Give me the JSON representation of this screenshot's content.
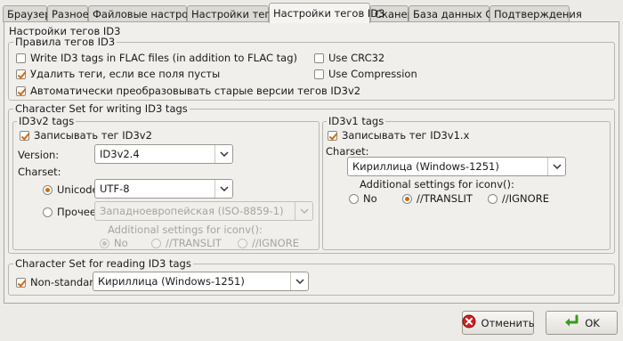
{
  "tabs": [
    "Браузер",
    "Разное",
    "Файловые настройки",
    "Настройки тегов",
    "Настройки тегов ID3",
    "Сканер",
    "База данных CD",
    "Подтверждения"
  ],
  "active_tab": "Настройки тегов ID3",
  "panel_title": "Настройки тегов ID3",
  "rules": {
    "title": "Правила тегов ID3",
    "write_flac": "Write ID3 tags in FLAC files (in addition to FLAC tag)",
    "delete_empty": "Удалить теги, если все поля пусты",
    "auto_convert": "Автоматически преобразовывать старые версии тегов ID3v2",
    "use_crc32": "Use CRC32",
    "use_compression": "Use Compression"
  },
  "writing": {
    "title": "Character Set for writing ID3 tags",
    "id3v2": {
      "title": "ID3v2 tags",
      "write_label": "Записывать тег ID3v2",
      "version_label": "Version:",
      "version_value": "ID3v2.4",
      "charset_label": "Charset:",
      "unicode_label": "Unicode",
      "unicode_value": "UTF-8",
      "other_label": "Прочее",
      "other_value": "Западноевропейская (ISO-8859-1)",
      "iconv_label": "Additional settings for iconv():",
      "opt_no": "No",
      "opt_translit": "//TRANSLIT",
      "opt_ignore": "//IGNORE"
    },
    "id3v1": {
      "title": "ID3v1 tags",
      "write_label": "Записывать тег ID3v1.x",
      "charset_label": "Charset:",
      "charset_value": "Кириллица (Windows-1251)",
      "iconv_label": "Additional settings for iconv():",
      "opt_no": "No",
      "opt_translit": "//TRANSLIT",
      "opt_ignore": "//IGNORE"
    }
  },
  "reading": {
    "title": "Character Set for reading ID3 tags",
    "nonstandard_label": "Non-standart:",
    "nonstandard_value": "Кириллица (Windows-1251)"
  },
  "buttons": {
    "cancel": "Отменить",
    "ok": "OK"
  },
  "colors": {
    "check_accent": "#d06a10",
    "cancel_icon": "#cc2222",
    "ok_icon": "#3a9a1e"
  }
}
